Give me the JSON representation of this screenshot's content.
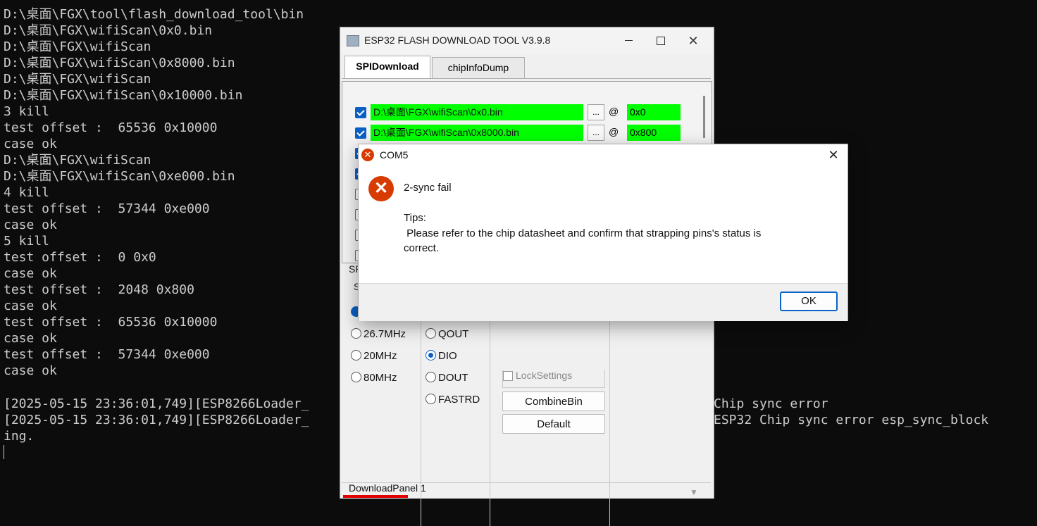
{
  "console": {
    "lines": [
      "D:\\桌面\\FGX\\tool\\flash_download_tool\\bin",
      "D:\\桌面\\FGX\\wifiScan\\0x0.bin",
      "D:\\桌面\\FGX\\wifiScan",
      "D:\\桌面\\FGX\\wifiScan\\0x8000.bin",
      "D:\\桌面\\FGX\\wifiScan",
      "D:\\桌面\\FGX\\wifiScan\\0x10000.bin",
      "3 kill",
      "test offset :  65536 0x10000",
      "case ok",
      "D:\\桌面\\FGX\\wifiScan",
      "D:\\桌面\\FGX\\wifiScan\\0xe000.bin",
      "4 kill",
      "test offset :  57344 0xe000",
      "case ok",
      "5 kill",
      "test offset :  0 0x0",
      "case ok",
      "test offset :  2048 0x800",
      "case ok",
      "test offset :  65536 0x10000",
      "case ok",
      "test offset :  57344 0xe000",
      "case ok"
    ],
    "log1_left": "[2025-05-15 23:36:01,749][ESP8266Loader_",
    "log1_right": "Chip sync error",
    "log2_left": "[2025-05-15 23:36:01,749][ESP8266Loader_",
    "log2_right": "ESP32 Chip sync error esp_sync_block",
    "log3": "ing."
  },
  "tool": {
    "title": "ESP32 FLASH DOWNLOAD TOOL V3.9.8",
    "tabs": [
      "SPIDownload",
      "chipInfoDump"
    ],
    "files": [
      {
        "path": "D:\\桌面\\FGX\\wifiScan\\0x0.bin",
        "addr": "0x0"
      },
      {
        "path": "D:\\桌面\\FGX\\wifiScan\\0x8000.bin",
        "addr": "0x800"
      }
    ],
    "browse_label": "...",
    "at_label": "@",
    "section_spi_fragment": "SP",
    "section_speed_fragment": "S",
    "speed_options": [
      "26.7MHz",
      "20MHz",
      "80MHz"
    ],
    "mode_options": [
      "QOUT",
      "DIO",
      "DOUT",
      "FASTRD"
    ],
    "mode_selected": "DIO",
    "lock_settings": "LockSettings",
    "combine_button": "CombineBin",
    "default_button": "Default",
    "panel_label": "DownloadPanel 1"
  },
  "dialog": {
    "title": "COM5",
    "message": "2-sync fail",
    "tips": "Tips:\n Please refer to the chip datasheet and confirm that strapping pins's status is\ncorrect.",
    "ok_label": "OK"
  },
  "colors": {
    "console_bg": "#0c0c0c",
    "console_fg": "#cccccc",
    "file_highlight": "#00ff00",
    "error_red": "#d83b01",
    "accent_blue": "#0a5fc4",
    "panel_underline": "#e00000"
  },
  "icons": {
    "app": "flash-tool-icon",
    "error": "error-x-icon",
    "close": "close-icon"
  }
}
